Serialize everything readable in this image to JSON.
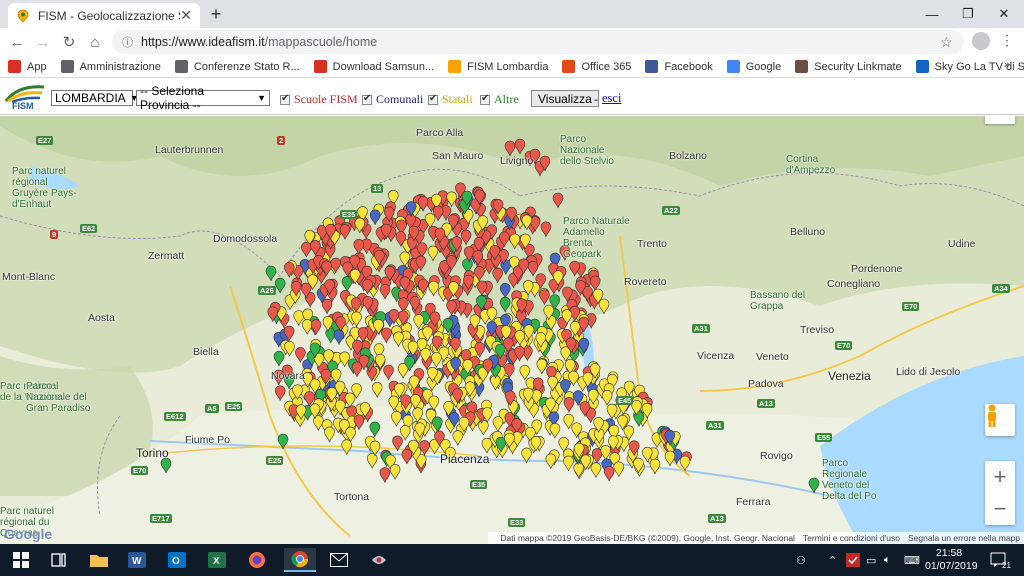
{
  "browser": {
    "tab_title": "FISM - Geolocalizzazione Scuole",
    "tab_close": "✕",
    "new_tab": "+",
    "url_host": "https://www.ideafism.it",
    "url_path": "/mappascuole/home",
    "window_controls": [
      "—",
      "❐",
      "✕"
    ]
  },
  "bookmarks": [
    {
      "label": "App",
      "icon": "apps-grid-icon",
      "color": "#d93025"
    },
    {
      "label": "Amministrazione",
      "icon": "globe-icon",
      "color": "#5f6368"
    },
    {
      "label": "Conferenze Stato R...",
      "icon": "globe-icon",
      "color": "#5f6368"
    },
    {
      "label": "Download Samsun...",
      "icon": "pin-icon",
      "color": "#d93025"
    },
    {
      "label": "FISM Lombardia",
      "icon": "fism-icon",
      "color": "#f4a300"
    },
    {
      "label": "Office 365",
      "icon": "office-icon",
      "color": "#e64a19"
    },
    {
      "label": "Facebook",
      "icon": "facebook-icon",
      "color": "#3b5998"
    },
    {
      "label": "Google",
      "icon": "google-icon",
      "color": "#4285f4"
    },
    {
      "label": "Security Linkmate",
      "icon": "linkmate-icon",
      "color": "#6d4c41"
    },
    {
      "label": "Sky Go La TV di Sky...",
      "icon": "sky-icon",
      "color": "#1565c0"
    }
  ],
  "bookmarks_more": "»",
  "appbar": {
    "logo_text": "FISM",
    "region": "LOMBARDIA",
    "province": "-- Seleziona Provincia --",
    "filters": [
      {
        "label": "Scuole FISM",
        "color": "#c62828"
      },
      {
        "label": "Comunali",
        "color": "#1a237e"
      },
      {
        "label": "Statali",
        "color": "#e6b800"
      },
      {
        "label": "Altre",
        "color": "#2e7d32"
      }
    ],
    "visualize_button": "Visualizza",
    "separator": "-",
    "logout_link": "esci"
  },
  "map": {
    "labels": [
      {
        "text": "Parco Alla",
        "name": "parco-alla"
      },
      {
        "text": "San Mauro",
        "name": "san-mauro"
      },
      {
        "text": "Livigno",
        "name": "livigno"
      },
      {
        "text": "Parco Nazionale dello Stelvio",
        "name": "parco-stelvio"
      },
      {
        "text": "Bolzano",
        "name": "bolzano"
      },
      {
        "text": "Cortina d'Ampezzo",
        "name": "cortina"
      },
      {
        "text": "Lauterbrunnen",
        "name": "lauterbrunnen"
      },
      {
        "text": "Parc naturel régional Gruyère Pays-d'Enhaut",
        "name": "parc-gruyere"
      },
      {
        "text": "Zermatt",
        "name": "zermatt"
      },
      {
        "text": "Domodossola",
        "name": "domodossola"
      },
      {
        "text": "Trento",
        "name": "trento"
      },
      {
        "text": "Belluno",
        "name": "belluno"
      },
      {
        "text": "Udine",
        "name": "udine"
      },
      {
        "text": "Parco Naturale Adamello Brenta Geopark",
        "name": "parco-adamello"
      },
      {
        "text": "Pordenone",
        "name": "pordenone"
      },
      {
        "text": "Rovereto",
        "name": "rovereto"
      },
      {
        "text": "Bassano del Grappa",
        "name": "bassano"
      },
      {
        "text": "Conegliano",
        "name": "conegliano"
      },
      {
        "text": "Aosta",
        "name": "aosta"
      },
      {
        "text": "Biella",
        "name": "biella"
      },
      {
        "text": "Treviso",
        "name": "treviso"
      },
      {
        "text": "Vicenza",
        "name": "vicenza"
      },
      {
        "text": "Veneto",
        "name": "veneto"
      },
      {
        "text": "Novara",
        "name": "novara"
      },
      {
        "text": "Padova",
        "name": "padova"
      },
      {
        "text": "Venezia",
        "name": "venezia"
      },
      {
        "text": "Lido di Jesolo",
        "name": "jesolo"
      },
      {
        "text": "Parc national de la Vanoise",
        "name": "vanoise"
      },
      {
        "text": "Parco Nazionale del Gran Paradiso",
        "name": "gran-paradiso"
      },
      {
        "text": "Torino",
        "name": "torino"
      },
      {
        "text": "Fiume Po",
        "name": "fiume-po"
      },
      {
        "text": "Piacenza",
        "name": "piacenza"
      },
      {
        "text": "Rovigo",
        "name": "rovigo"
      },
      {
        "text": "Parco Regionale Veneto del Delta del Po",
        "name": "parco-delta-po"
      },
      {
        "text": "Ferrara",
        "name": "ferrara"
      },
      {
        "text": "Tortona",
        "name": "tortona"
      },
      {
        "text": "Parc naturel régional du Queyras",
        "name": "queyras"
      },
      {
        "text": "Mont-Blanc",
        "name": "mont-blanc"
      }
    ],
    "attribution": "Dati mappa ©2019 GeoBasis-DE/BKG (©2009), Google, Inst. Geogr. Nacional",
    "terms": "Termini e condizioni d'uso",
    "report": "Segnala un errore nella mapp",
    "zoom_in": "+",
    "zoom_out": "−",
    "google": "Google"
  },
  "taskbar": {
    "time": "21:58",
    "date": "01/07/2019",
    "notifications": "21"
  }
}
